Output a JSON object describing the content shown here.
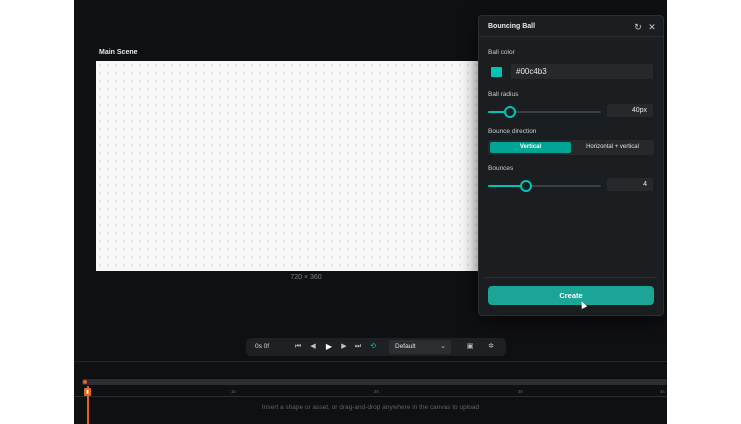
{
  "scene": {
    "title": "Main Scene",
    "dimensions": "720 × 360"
  },
  "panel": {
    "title": "Bouncing Ball",
    "refresh_icon": "refresh-icon",
    "close_icon": "close-icon",
    "ball_color": {
      "label": "Ball color",
      "value": "#00c4b3",
      "swatch": "#00c4b3"
    },
    "ball_radius": {
      "label": "Ball radius",
      "value": "40px",
      "fraction": 0.19
    },
    "bounce_direction": {
      "label": "Bounce direction",
      "options": [
        "Vertical",
        "Horizontal + vertical"
      ],
      "selected": "Vertical"
    },
    "bounces": {
      "label": "Bounces",
      "value": "4",
      "fraction": 0.33
    },
    "create_label": "Create"
  },
  "toolbar": {
    "time": "0s 0f",
    "icons": [
      "skip-back-icon",
      "step-back-icon",
      "play-icon",
      "step-forward-icon",
      "skip-forward-icon",
      "loop-icon",
      "caption-icon",
      "settings-icon"
    ],
    "speed": "Default"
  },
  "timeline": {
    "ruler_labels": [
      "1s",
      "2s",
      "3s",
      "4s"
    ],
    "hint": "Insert a shape or asset, or drag-and-drop anywhere in the canvas to upload"
  },
  "colors": {
    "accent": "#00c4b3",
    "button": "#1ba596",
    "playhead": "#e2661c",
    "background": "#0f1012"
  }
}
